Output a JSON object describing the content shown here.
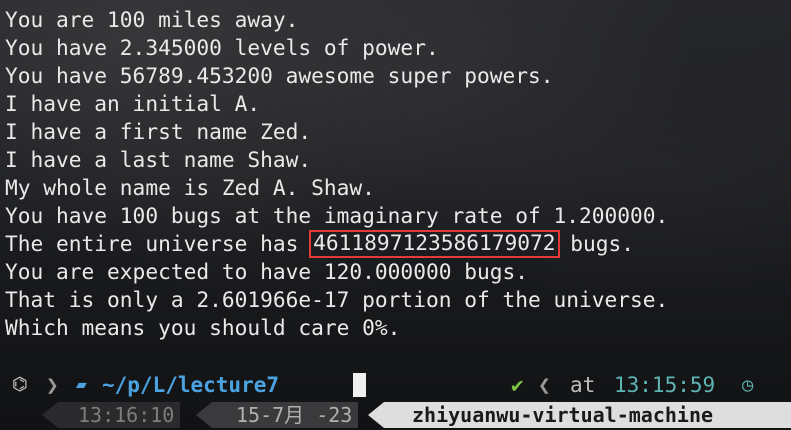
{
  "output_lines": [
    "You are 100 miles away.",
    "You have 2.345000 levels of power.",
    "You have 56789.453200 awesome super powers.",
    "I have an initial A.",
    "I have a first name Zed.",
    "I have a last name Shaw.",
    "My whole name is Zed A. Shaw.",
    "You have 100 bugs at the imaginary rate of 1.200000.",
    {
      "before": "The entire universe has ",
      "highlight": "4611897123586179072",
      "after": " bugs."
    },
    "You are expected to have 120.000000 bugs.",
    "That is only a 2.601966e-17 portion of the universe.",
    "Which means you should care 0%."
  ],
  "prompt": {
    "os_icon": "",
    "folder_icon": "",
    "path_prefix": "~/p/L/",
    "path_dir": "lecture7",
    "status_icon": "✔",
    "at_label": "at",
    "time": "13:15:59",
    "clock_icon": "◷"
  },
  "status_bar": {
    "time": "13:16:10",
    "date": "15-7月 -23",
    "hostname": "zhiyuanwu-virtual-machine"
  },
  "colors": {
    "text": "#e9e9e9",
    "highlight_border": "#e33a3a",
    "path": "#4aa3e0",
    "check": "#7cc243",
    "time": "#5fb4b4"
  }
}
